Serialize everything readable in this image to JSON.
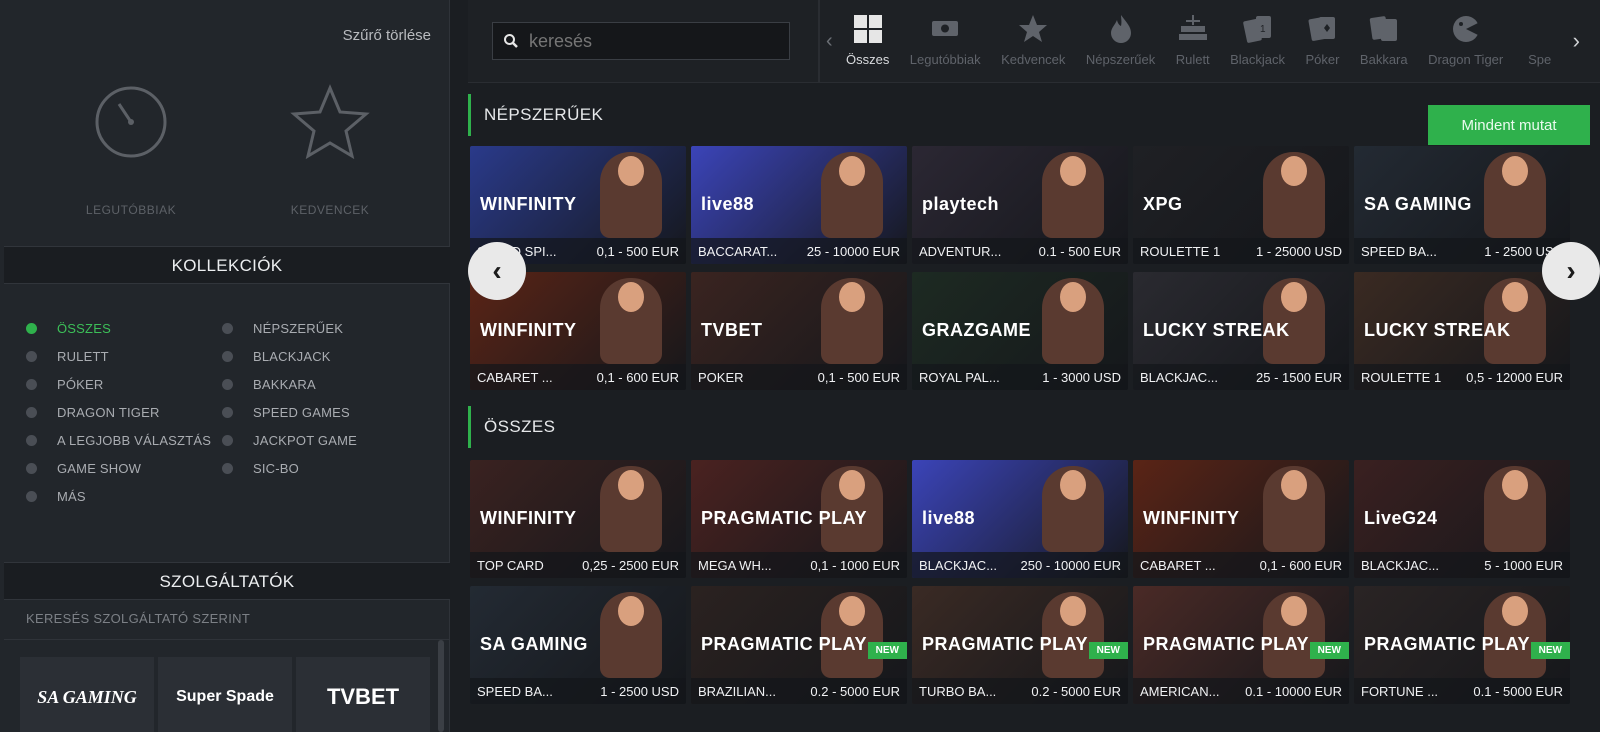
{
  "sidebar": {
    "clear_filter": "Szűrő törlése",
    "quick": [
      {
        "label": "LEGUTÓBBIAK",
        "icon": "timer-icon"
      },
      {
        "label": "KEDVENCEK",
        "icon": "star-icon"
      }
    ],
    "collections_title": "KOLLEKCIÓK",
    "collections": [
      {
        "label": "ÖSSZES",
        "active": true
      },
      {
        "label": "NÉPSZERŰEK"
      },
      {
        "label": "RULETT"
      },
      {
        "label": "BLACKJACK"
      },
      {
        "label": "PÓKER"
      },
      {
        "label": "BAKKARA"
      },
      {
        "label": "DRAGON TIGER"
      },
      {
        "label": "SPEED GAMES"
      },
      {
        "label": "A LEGJOBB VÁLASZTÁS"
      },
      {
        "label": "JACKPOT GAME"
      },
      {
        "label": "GAME SHOW"
      },
      {
        "label": "SIC-BO"
      },
      {
        "label": "MÁS"
      }
    ],
    "providers_title": "SZOLGÁLTATÓK",
    "provider_search": "KERESÉS SZOLGÁLTATÓ SZERINT",
    "providers": [
      "SA GAMING",
      "Super Spade",
      "TVBET"
    ]
  },
  "topbar": {
    "search_placeholder": "keresés",
    "categories": [
      {
        "label": "Összes",
        "icon": "grid-icon",
        "active": true
      },
      {
        "label": "Legutóbbiak",
        "icon": "money-icon"
      },
      {
        "label": "Kedvencek",
        "icon": "star-icon"
      },
      {
        "label": "Népszerűek",
        "icon": "fire-icon"
      },
      {
        "label": "Rulett",
        "icon": "roulette-icon"
      },
      {
        "label": "Blackjack",
        "icon": "cards-icon"
      },
      {
        "label": "Póker",
        "icon": "poker-icon"
      },
      {
        "label": "Bakkara",
        "icon": "baccarat-icon"
      },
      {
        "label": "Dragon Tiger",
        "icon": "dragon-icon"
      },
      {
        "label": "Spe",
        "icon": "speed-icon"
      }
    ]
  },
  "popular": {
    "title": "NÉPSZERŰEK",
    "show_all": "Mindent mutat",
    "games": [
      {
        "name": "SPEED SPI...",
        "limits": "0,1 - 500 EUR",
        "provider": "WINFINITY",
        "bg": "#2a3a8a"
      },
      {
        "name": "BACCARAT...",
        "limits": "25 - 10000 EUR",
        "provider": "live88",
        "bg": "#3b44b8"
      },
      {
        "name": "ADVENTUR...",
        "limits": "0.1 - 500 EUR",
        "provider": "playtech",
        "bg": "#2b2733"
      },
      {
        "name": "ROULETTE 1",
        "limits": "1 - 25000 USD",
        "provider": "XPG",
        "bg": "#1f2024"
      },
      {
        "name": "SPEED BA...",
        "limits": "1 - 2500 USD",
        "provider": "SA GAMING",
        "bg": "#232a33"
      },
      {
        "name": "CABARET ...",
        "limits": "0,1 - 600 EUR",
        "provider": "WINFINITY",
        "bg": "#5a2416"
      },
      {
        "name": "POKER",
        "limits": "0,1 - 500 EUR",
        "provider": "TVBET",
        "bg": "#3a2420"
      },
      {
        "name": "ROYAL PAL...",
        "limits": "1 - 3000 USD",
        "provider": "GRAZGAME",
        "bg": "#1d2a22"
      },
      {
        "name": "BLACKJAC...",
        "limits": "25 - 1500 EUR",
        "provider": "LUCKY STREAK",
        "bg": "#2a2a30"
      },
      {
        "name": "ROULETTE 1",
        "limits": "0,5 - 12000 EUR",
        "provider": "LUCKY STREAK",
        "bg": "#3a2a22"
      }
    ]
  },
  "all": {
    "title": "ÖSSZES",
    "games": [
      {
        "name": "TOP CARD",
        "limits": "0,25 - 2500 EUR",
        "provider": "WINFINITY",
        "bg": "#3a2220"
      },
      {
        "name": "MEGA WH...",
        "limits": "0,1 - 1000 EUR",
        "provider": "PRAGMATIC PLAY",
        "bg": "#4a2220"
      },
      {
        "name": "BLACKJAC...",
        "limits": "250 - 10000 EUR",
        "provider": "live88",
        "bg": "#3b44b8"
      },
      {
        "name": "CABARET ...",
        "limits": "0,1 - 600 EUR",
        "provider": "WINFINITY",
        "bg": "#5a2416"
      },
      {
        "name": "BLACKJAC...",
        "limits": "5 - 1000 EUR",
        "provider": "LiveG24",
        "bg": "#3a2020"
      },
      {
        "name": "SPEED BA...",
        "limits": "1 - 2500 USD",
        "provider": "SA GAMING",
        "bg": "#232a33"
      },
      {
        "name": "BRAZILIAN...",
        "limits": "0.2 - 5000 EUR",
        "provider": "PRAGMATIC PLAY",
        "bg": "#2b2220",
        "new": "NEW"
      },
      {
        "name": "TURBO BA...",
        "limits": "0.2 - 5000 EUR",
        "provider": "PRAGMATIC PLAY",
        "bg": "#3a2a24",
        "new": "NEW"
      },
      {
        "name": "AMERICAN...",
        "limits": "0.1 - 10000 EUR",
        "provider": "PRAGMATIC PLAY",
        "bg": "#4a2a26",
        "new": "NEW"
      },
      {
        "name": "FORTUNE ...",
        "limits": "0.1 - 5000 EUR",
        "provider": "PRAGMATIC PLAY",
        "bg": "#2a2424",
        "new": "NEW"
      }
    ]
  },
  "colors": {
    "accent": "#2fb14c"
  }
}
